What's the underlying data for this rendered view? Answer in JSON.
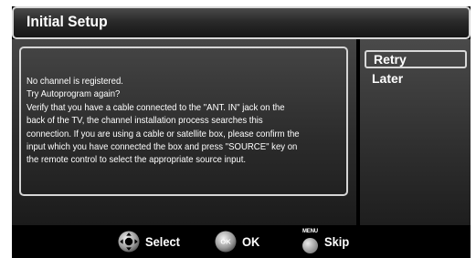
{
  "dialog": {
    "title": "Initial Setup",
    "message": "No channel is registered.\nTry Autoprogram again?\nVerify that you have a cable connected to the \"ANT. IN\" jack on the\nback of the TV, the channel installation process searches this\nconnection. If you are using a cable or satellite box, please confirm the\ninput which you have connected the box and press \"SOURCE\" key on\nthe remote control to select the appropriate source input."
  },
  "options": [
    {
      "label": "Retry",
      "selected": true
    },
    {
      "label": "Later",
      "selected": false
    }
  ],
  "footer": {
    "select_label": "Select",
    "ok_icon_text": "OK",
    "ok_label": "OK",
    "menu_icon_text": "MENU",
    "skip_label": "Skip"
  },
  "colors": {
    "frame": "#000000",
    "border": "#d8d8d8",
    "text": "#ffffff"
  }
}
